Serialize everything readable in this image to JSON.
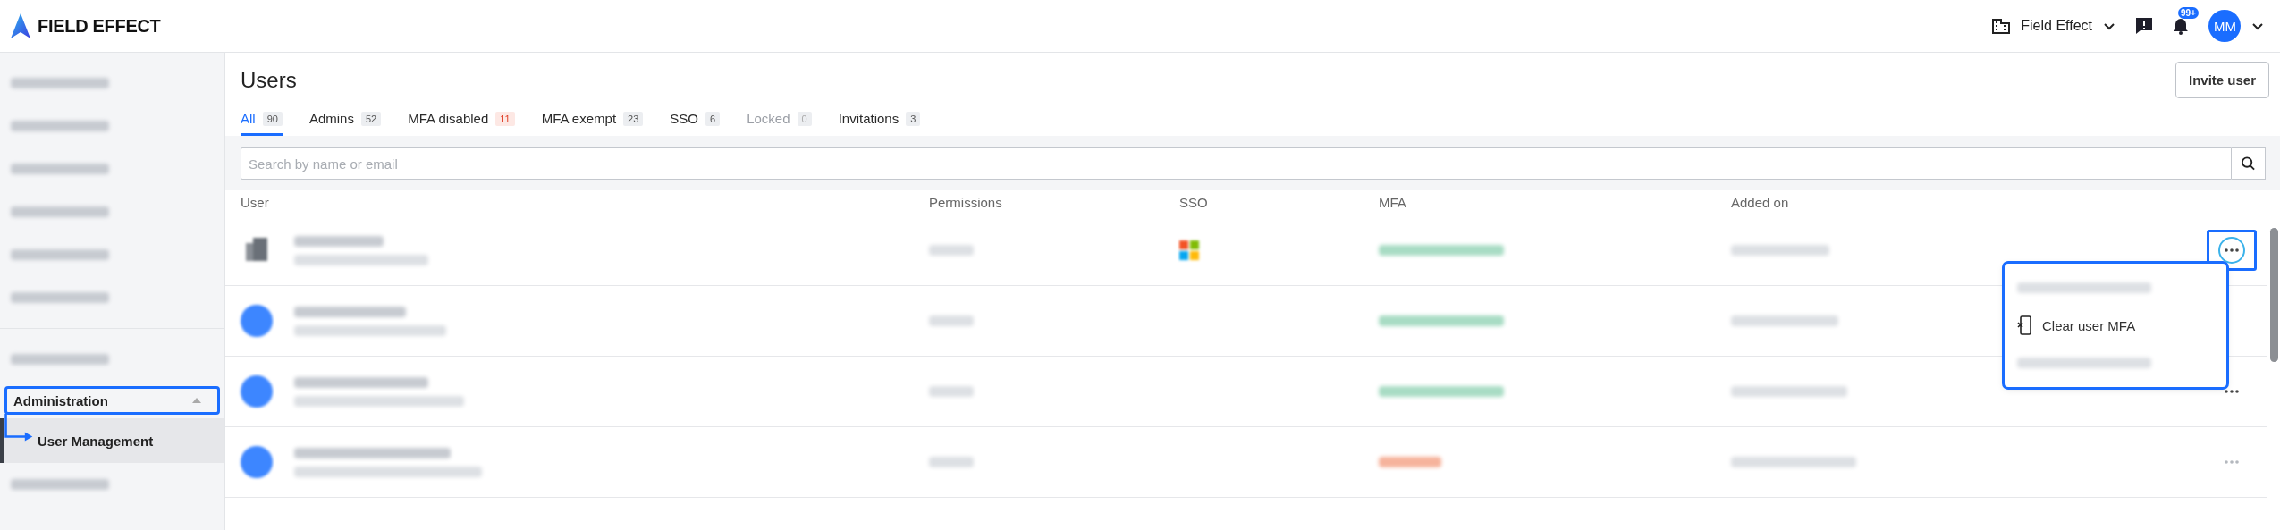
{
  "header": {
    "logo": "FIELD EFFECT",
    "organization": "Field Effect",
    "notification_count": "99+",
    "avatar_initials": "MM"
  },
  "sidebar": {
    "items": [
      {
        "kind": "redacted"
      },
      {
        "kind": "redacted"
      },
      {
        "kind": "redacted"
      },
      {
        "kind": "redacted"
      },
      {
        "kind": "redacted"
      },
      {
        "kind": "redacted"
      },
      {
        "kind": "divider"
      },
      {
        "kind": "redacted"
      },
      {
        "kind": "section",
        "label": "Administration",
        "expanded": true,
        "highlighted": true,
        "children": [
          {
            "label": "User Management",
            "selected": true
          }
        ]
      },
      {
        "kind": "redacted"
      }
    ]
  },
  "page": {
    "title": "Users",
    "invite_button": "Invite user"
  },
  "tabs": [
    {
      "label": "All",
      "count": "90",
      "selected": true,
      "disabled": false,
      "alert": false
    },
    {
      "label": "Admins",
      "count": "52",
      "selected": false,
      "disabled": false,
      "alert": false
    },
    {
      "label": "MFA disabled",
      "count": "11",
      "selected": false,
      "disabled": false,
      "alert": true
    },
    {
      "label": "MFA exempt",
      "count": "23",
      "selected": false,
      "disabled": false,
      "alert": false
    },
    {
      "label": "SSO",
      "count": "6",
      "selected": false,
      "disabled": false,
      "alert": false
    },
    {
      "label": "Locked",
      "count": "0",
      "selected": false,
      "disabled": true,
      "alert": false
    },
    {
      "label": "Invitations",
      "count": "3",
      "selected": false,
      "disabled": false,
      "alert": false
    }
  ],
  "search": {
    "placeholder": "Search by name or email"
  },
  "table": {
    "columns": [
      "User",
      "Permissions",
      "SSO",
      "MFA",
      "Added on"
    ],
    "rows": [
      {
        "kind": "organization",
        "sso": true,
        "mfa_enabled": true,
        "menu_button": true,
        "highlighted": true,
        "disabled": false
      },
      {
        "kind": "person",
        "sso": false,
        "mfa_enabled": true,
        "menu_button": false,
        "highlighted": false
      },
      {
        "kind": "person",
        "sso": false,
        "mfa_enabled": true,
        "menu_button": true,
        "highlighted": false,
        "disabled": false
      },
      {
        "kind": "person",
        "sso": false,
        "mfa_enabled": false,
        "menu_button": true,
        "highlighted": false,
        "disabled": true
      }
    ]
  },
  "row_menu": {
    "highlighted": true,
    "items": [
      {
        "kind": "redacted"
      },
      {
        "kind": "action",
        "label": "Clear user MFA"
      },
      {
        "kind": "redacted"
      }
    ]
  }
}
